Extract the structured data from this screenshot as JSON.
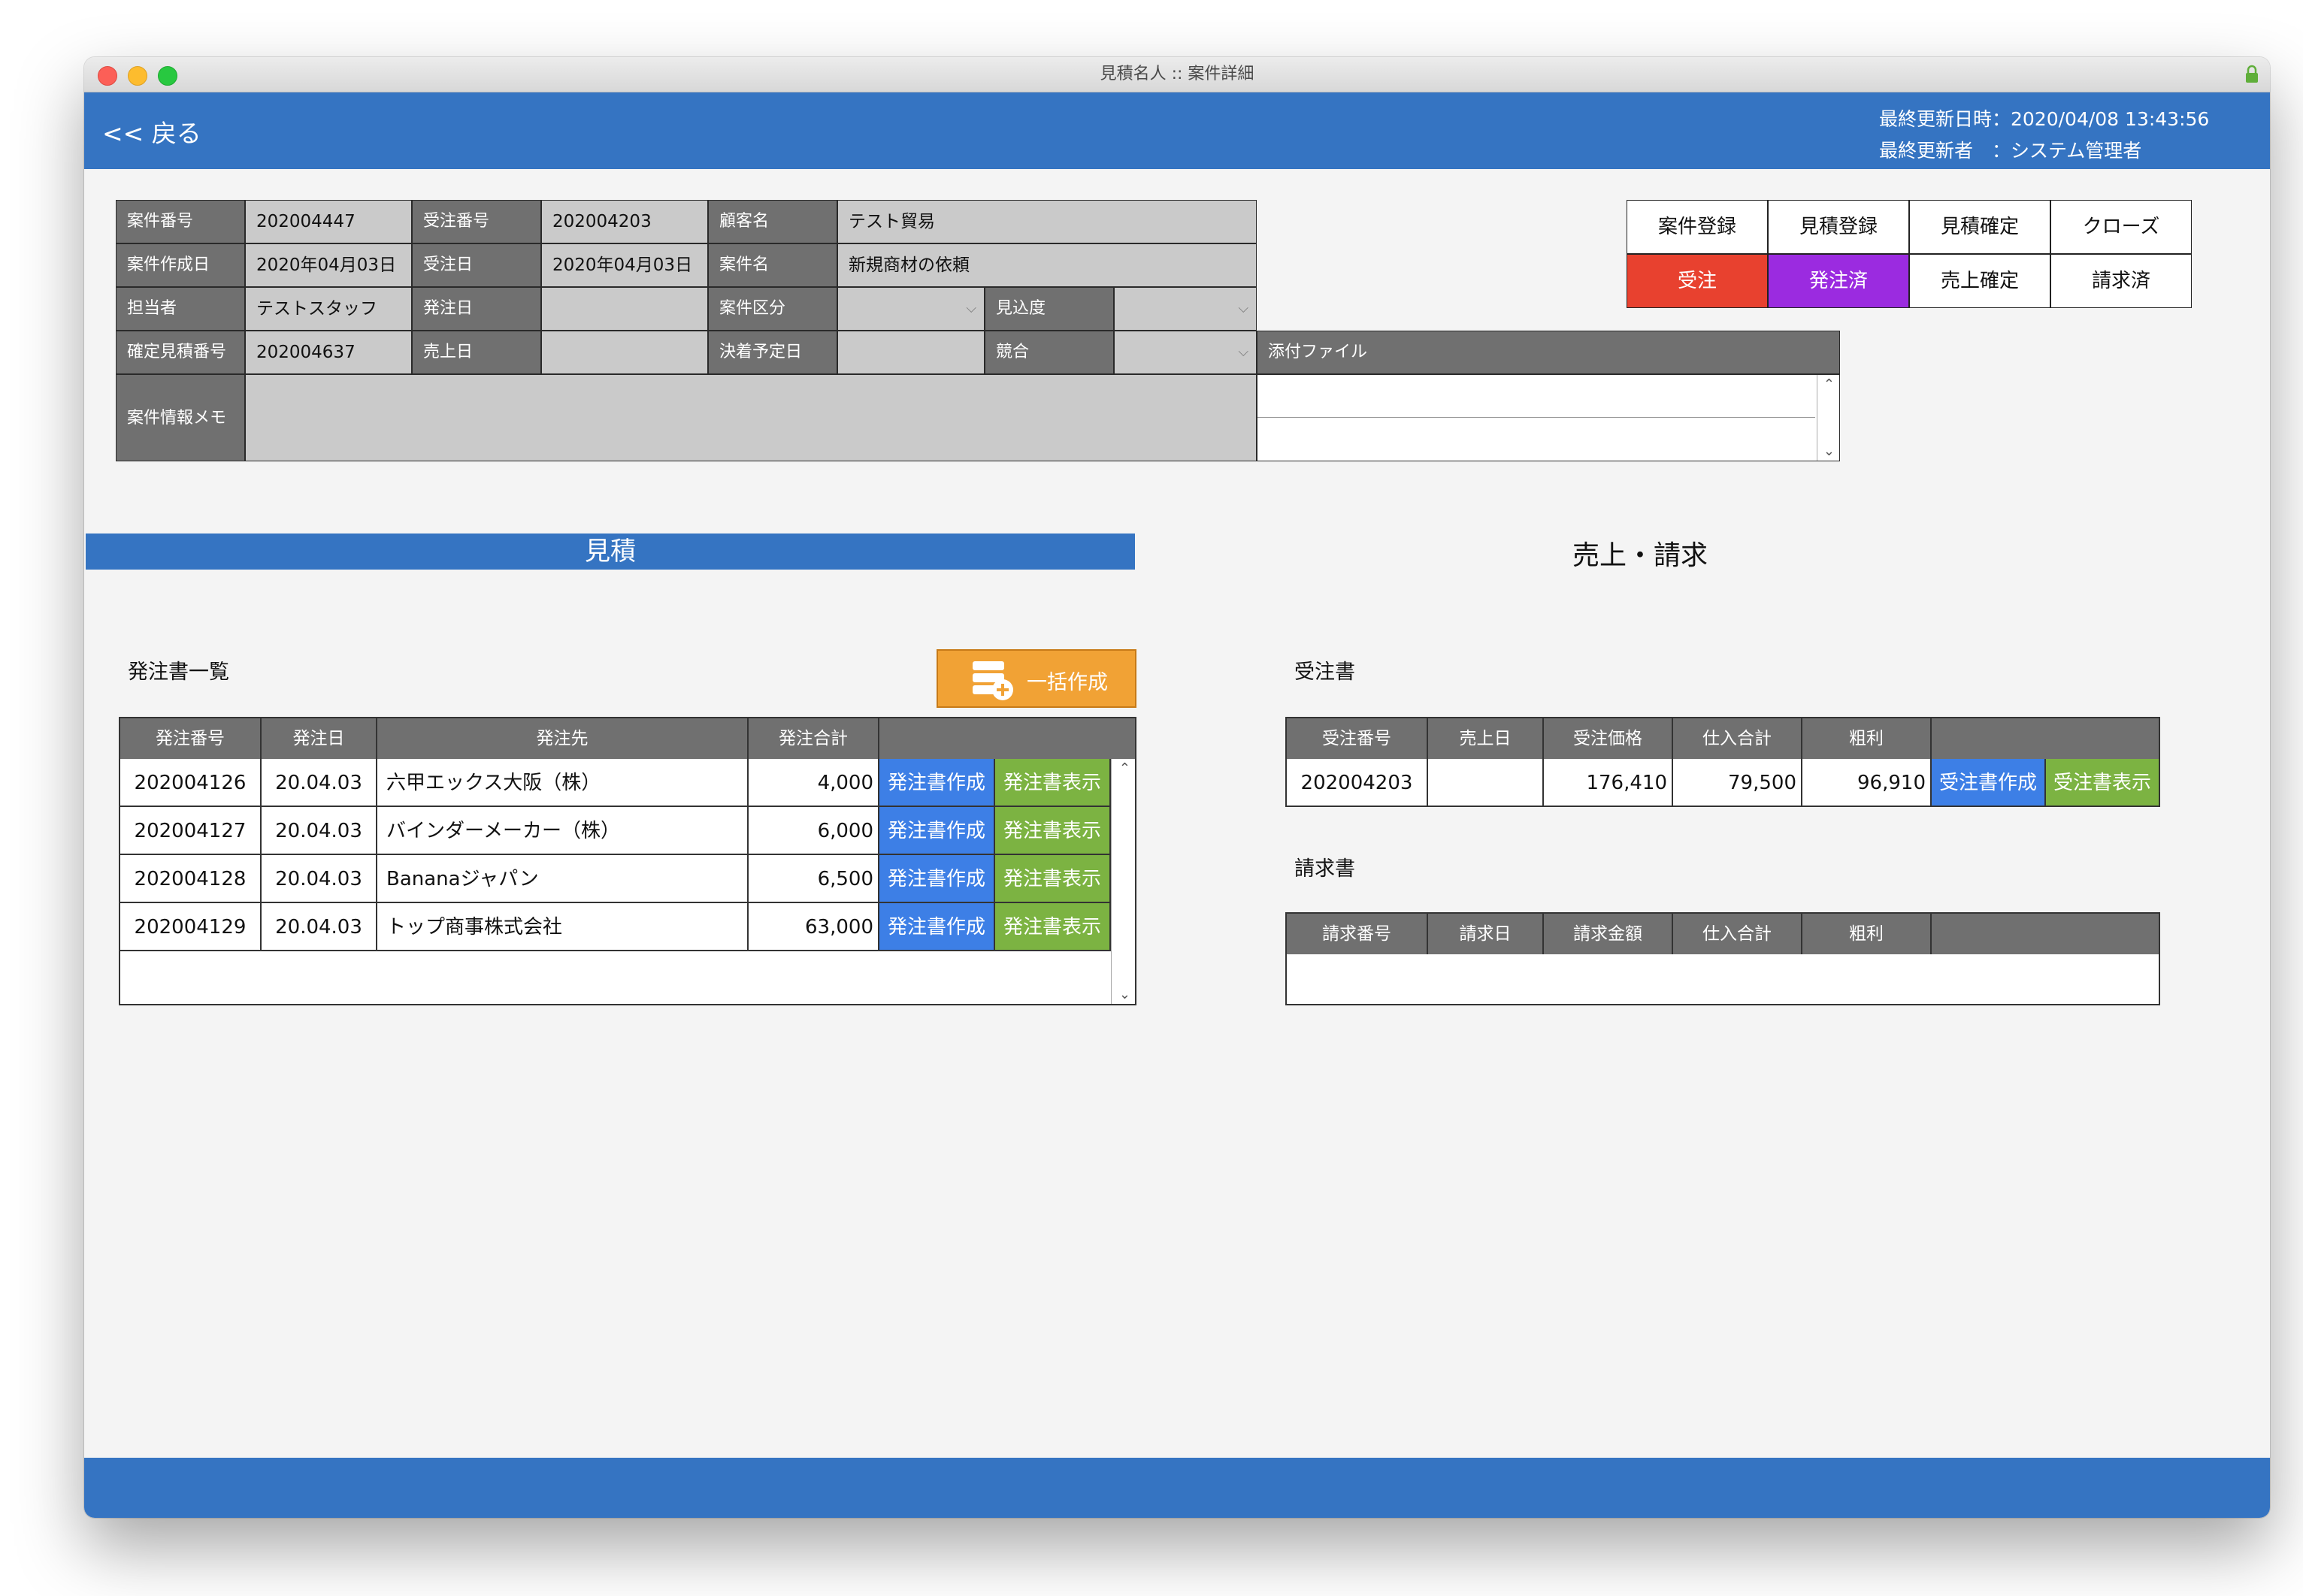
{
  "window": {
    "title": "見積名人 :: 案件詳細"
  },
  "header": {
    "back_label": "<< 戻る",
    "last_updated": "最終更新日時：2020/04/08 13:43:56",
    "last_updater": "最終更新者　：システム管理者"
  },
  "info": {
    "case_no_label": "案件番号",
    "case_no": "202004447",
    "order_no_label": "受注番号",
    "order_no": "202004203",
    "customer_label": "顧客名",
    "customer": "テスト貿易",
    "created_label": "案件作成日",
    "created": "2020年04月03日",
    "order_date_label": "受注日",
    "order_date": "2020年04月03日",
    "case_name_label": "案件名",
    "case_name": "新規商材の依頼",
    "staff_label": "担当者",
    "staff": "テストスタッフ",
    "po_date_label": "発注日",
    "po_date": "",
    "category_label": "案件区分",
    "category": "",
    "prospect_label": "見込度",
    "prospect": "",
    "quote_no_label": "確定見積番号",
    "quote_no": "202004637",
    "sales_date_label": "売上日",
    "sales_date": "",
    "decision_date_label": "決着予定日",
    "decision_date": "",
    "competitor_label": "競合",
    "competitor": "",
    "attachment_label": "添付ファイル",
    "memo_label": "案件情報メモ",
    "memo": ""
  },
  "status": {
    "row1": [
      "案件登録",
      "見積登録",
      "見積確定",
      "クローズ"
    ],
    "row2": [
      "受注",
      "発注済",
      "売上確定",
      "請求済"
    ],
    "row2_colors": [
      "#e8412f",
      "#9b2be0",
      "#ffffff",
      "#ffffff"
    ]
  },
  "sections": {
    "quote": "見積",
    "sales": "売上・請求",
    "po_list": "発注書一覧",
    "bulk_create": "一括作成",
    "order_doc": "受注書",
    "invoice_doc": "請求書"
  },
  "po_table": {
    "headers": [
      "発注番号",
      "発注日",
      "発注先",
      "発注合計",
      ""
    ],
    "rows": [
      [
        "202004126",
        "20.04.03",
        "六甲エックス大阪（株）",
        "4,000"
      ],
      [
        "202004127",
        "20.04.03",
        "バインダーメーカー（株）",
        "6,000"
      ],
      [
        "202004128",
        "20.04.03",
        "Bananaジャパン",
        "6,500"
      ],
      [
        "202004129",
        "20.04.03",
        "トップ商事株式会社",
        "63,000"
      ]
    ],
    "create_label": "発注書作成",
    "show_label": "発注書表示"
  },
  "order_table": {
    "headers": [
      "受注番号",
      "売上日",
      "受注価格",
      "仕入合計",
      "粗利",
      ""
    ],
    "rows": [
      [
        "202004203",
        "",
        "176,410",
        "79,500",
        "96,910"
      ]
    ],
    "create_label": "受注書作成",
    "show_label": "受注書表示"
  },
  "invoice_table": {
    "headers": [
      "請求番号",
      "請求日",
      "請求金額",
      "仕入合計",
      "粗利",
      ""
    ]
  }
}
